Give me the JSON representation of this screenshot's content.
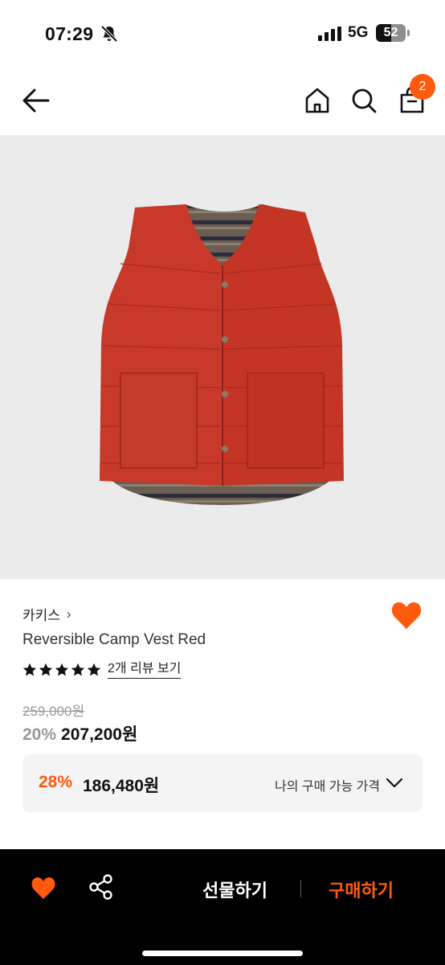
{
  "status_bar": {
    "time": "07:29",
    "network": "5G",
    "battery": "52",
    "battery_level": 0.52
  },
  "nav": {
    "cart_count": "2",
    "icons": [
      "back-arrow-icon",
      "home-icon",
      "search-icon",
      "shopping-bag-icon"
    ]
  },
  "product": {
    "brand": "카키스",
    "brand_chevron": "›",
    "name": "Reversible Camp Vest Red",
    "rating": 5,
    "review_link": "2개 리뷰 보기",
    "original_price": "259,000원",
    "discount_rate": "20%",
    "sale_price": "207,200원",
    "liked": true
  },
  "my_price": {
    "discount_rate": "28%",
    "price": "186,480원",
    "label": "나의 구매 가능 가격"
  },
  "bottom_bar": {
    "gift_label": "선물하기",
    "buy_label": "구매하기"
  },
  "colors": {
    "accent": "#ff5a0e",
    "hero_bg": "#ebebeb",
    "vest_red": "#c9392a"
  }
}
